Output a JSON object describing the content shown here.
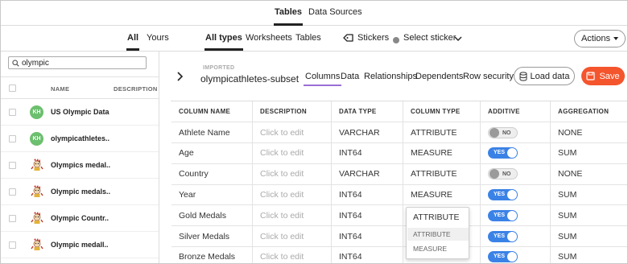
{
  "top_tabs": [
    {
      "label": "Tables",
      "active": true
    },
    {
      "label": "Data Sources",
      "active": false
    }
  ],
  "sub_nav": {
    "owner_filters": [
      "All",
      "Yours"
    ],
    "type_filters": [
      "All types",
      "Worksheets",
      "Tables"
    ],
    "stickers_label": "Stickers",
    "select_sticker_label": "Select sticker",
    "actions_label": "Actions"
  },
  "left_panel": {
    "search_value": "olympic",
    "header": {
      "name": "NAME",
      "description": "DESCRIPTION"
    },
    "items": [
      {
        "name": "US Olympic Data",
        "avatar": "KH",
        "avatar_type": "initials"
      },
      {
        "name": "olympicathletes..",
        "avatar": "KH",
        "avatar_type": "initials"
      },
      {
        "name": "Olympics medal..",
        "avatar": "",
        "avatar_type": "mascot"
      },
      {
        "name": "Olympic medals..",
        "avatar": "",
        "avatar_type": "mascot"
      },
      {
        "name": "Olympic Countr..",
        "avatar": "",
        "avatar_type": "mascot"
      },
      {
        "name": "Olympic medall..",
        "avatar": "",
        "avatar_type": "mascot"
      }
    ]
  },
  "detail": {
    "imported_label": "IMPORTED",
    "table_name": "olympicathletes-subset",
    "tabs": [
      {
        "label": "Columns",
        "active": true
      },
      {
        "label": "Data",
        "active": false
      },
      {
        "label": "Relationships",
        "active": false
      },
      {
        "label": "Dependents",
        "active": false
      },
      {
        "label": "Row security",
        "active": false
      }
    ],
    "load_data_label": "Load data",
    "save_label": "Save"
  },
  "columns_table": {
    "headers": [
      "COLUMN NAME",
      "DESCRIPTION",
      "DATA TYPE",
      "COLUMN TYPE",
      "ADDITIVE",
      "AGGREGATION"
    ],
    "rows": [
      {
        "name": "Athlete Name",
        "description": "Click to edit",
        "data_type": "VARCHAR",
        "column_type": "ATTRIBUTE",
        "additive": "NO",
        "aggregation": "NONE"
      },
      {
        "name": "Age",
        "description": "Click to edit",
        "data_type": "INT64",
        "column_type": "MEASURE",
        "additive": "YES",
        "aggregation": "SUM"
      },
      {
        "name": "Country",
        "description": "Click to edit",
        "data_type": "VARCHAR",
        "column_type": "ATTRIBUTE",
        "additive": "NO",
        "aggregation": "NONE"
      },
      {
        "name": "Year",
        "description": "Click to edit",
        "data_type": "INT64",
        "column_type": "MEASURE",
        "additive": "YES",
        "aggregation": "SUM"
      },
      {
        "name": "Gold Medals",
        "description": "Click to edit",
        "data_type": "INT64",
        "column_type": "ATTRIBUTE",
        "additive": "YES",
        "aggregation": "SUM"
      },
      {
        "name": "Silver Medals",
        "description": "Click to edit",
        "data_type": "INT64",
        "column_type": "",
        "additive": "YES",
        "aggregation": "SUM"
      },
      {
        "name": "Bronze Medals",
        "description": "Click to edit",
        "data_type": "INT64",
        "column_type": "",
        "additive": "YES",
        "aggregation": "SUM"
      }
    ]
  },
  "column_type_dropdown": {
    "selected": "ATTRIBUTE",
    "options": [
      "ATTRIBUTE",
      "MEASURE"
    ],
    "highlighted": "ATTRIBUTE"
  },
  "colors": {
    "accent_purple": "#9b6fd4",
    "toggle_on": "#3b82e6",
    "save_orange": "#f4552d",
    "avatar_green": "#6cbf6e"
  }
}
